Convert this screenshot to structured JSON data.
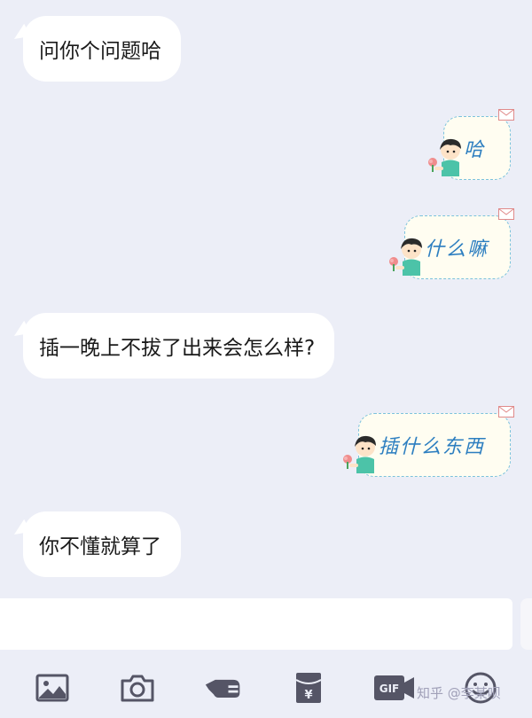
{
  "messages": [
    {
      "side": "in",
      "text": "问你个问题哈"
    },
    {
      "side": "out",
      "text": "哈"
    },
    {
      "side": "out",
      "text": "什么嘛"
    },
    {
      "side": "in",
      "text": "插一晚上不拔了出来会怎么样?"
    },
    {
      "side": "out",
      "text": "插什么东西"
    },
    {
      "side": "in",
      "text": "你不懂就算了"
    }
  ],
  "input": {
    "value": ""
  },
  "toolbar": {
    "icons": [
      "image-icon",
      "camera-icon",
      "poke-icon",
      "red-packet-icon",
      "gif-icon",
      "emoji-icon"
    ],
    "red_packet_symbol": "¥",
    "gif_label": "GIF"
  },
  "watermark": {
    "text": "知乎 @李某呗"
  },
  "colors": {
    "background": "#eceef7",
    "incoming_bubble": "#ffffff",
    "outgoing_bubble": "#fffdf1",
    "outgoing_border": "#7cc2dc",
    "outgoing_text": "#2c7ec0",
    "toolbar_icon": "#555566"
  }
}
